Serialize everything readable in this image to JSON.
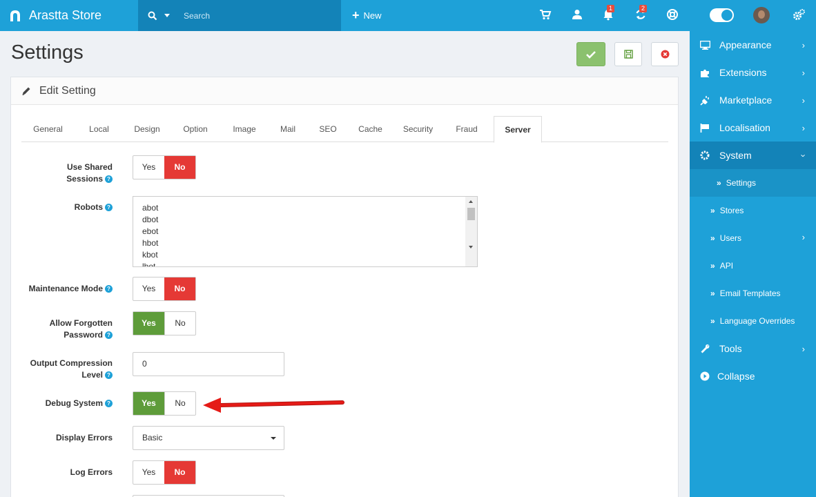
{
  "header": {
    "brand": "Arastta Store",
    "search_placeholder": "Search",
    "new_label": "New",
    "notifications_badge": "1",
    "updates_badge": "2"
  },
  "page": {
    "title": "Settings"
  },
  "panel": {
    "title": "Edit Setting"
  },
  "tabs": [
    {
      "label": "General"
    },
    {
      "label": "Local"
    },
    {
      "label": "Design"
    },
    {
      "label": "Option"
    },
    {
      "label": "Image"
    },
    {
      "label": "Mail"
    },
    {
      "label": "SEO"
    },
    {
      "label": "Cache"
    },
    {
      "label": "Security"
    },
    {
      "label": "Fraud"
    },
    {
      "label": "Server",
      "active": true
    }
  ],
  "form": {
    "shared_sessions": {
      "label_1": "Use Shared",
      "label_2": "Sessions",
      "yes": "Yes",
      "no": "No",
      "value": "No"
    },
    "robots": {
      "label": "Robots",
      "lines": [
        "abot",
        "dbot",
        "ebot",
        "hbot",
        "kbot",
        "lbot"
      ]
    },
    "maintenance": {
      "label": "Maintenance Mode",
      "yes": "Yes",
      "no": "No",
      "value": "No"
    },
    "forgotten_password": {
      "label_1": "Allow Forgotten",
      "label_2": "Password",
      "yes": "Yes",
      "no": "No",
      "value": "Yes"
    },
    "compression": {
      "label_1": "Output Compression",
      "label_2": "Level",
      "value": "0"
    },
    "debug_system": {
      "label": "Debug System",
      "yes": "Yes",
      "no": "No",
      "value": "Yes"
    },
    "display_errors": {
      "label": "Display Errors",
      "value": "Basic"
    },
    "log_errors": {
      "label": "Log Errors",
      "yes": "Yes",
      "no": "No",
      "value": "No"
    }
  },
  "sidebar": {
    "items": [
      {
        "label": "Appearance",
        "icon": "monitor-icon"
      },
      {
        "label": "Extensions",
        "icon": "puzzle-icon"
      },
      {
        "label": "Marketplace",
        "icon": "plug-icon"
      },
      {
        "label": "Localisation",
        "icon": "flag-icon"
      },
      {
        "label": "System",
        "icon": "gear-icon"
      }
    ],
    "system_sub": [
      "Settings",
      "Stores",
      "Users",
      "API",
      "Email Templates",
      "Language Overrides"
    ],
    "tools": "Tools",
    "collapse": "Collapse"
  },
  "colors": {
    "primary": "#1ea1d8",
    "primary_dark": "#1383b8",
    "danger": "#e53935",
    "success": "#5e9c3a"
  }
}
